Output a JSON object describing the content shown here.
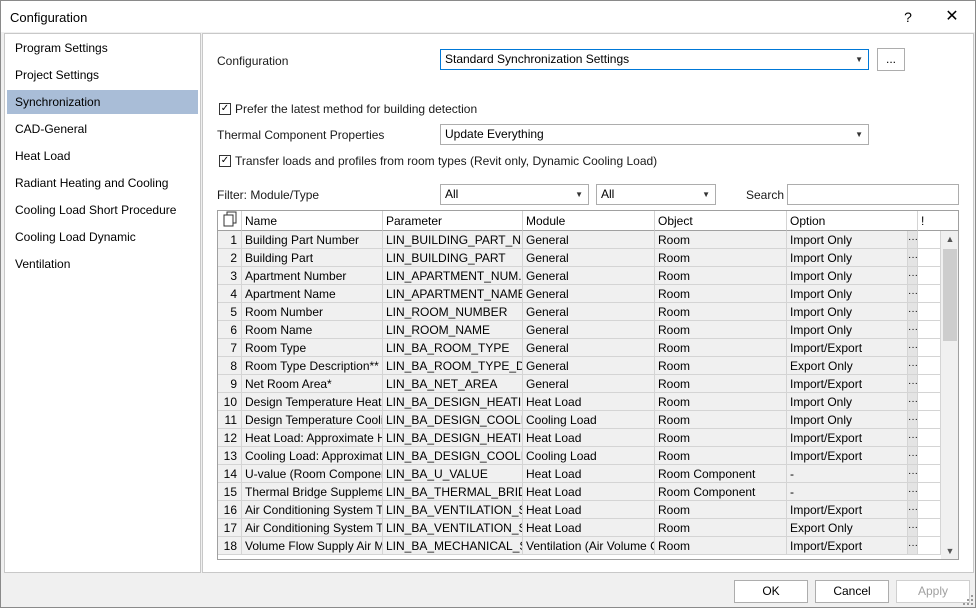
{
  "window": {
    "title": "Configuration",
    "help": "?",
    "close": "✕"
  },
  "sidebar": {
    "items": [
      {
        "label": "Program Settings",
        "active": false
      },
      {
        "label": "Project Settings",
        "active": false
      },
      {
        "label": "Synchronization",
        "active": true
      },
      {
        "label": "CAD-General",
        "active": false
      },
      {
        "label": "Heat Load",
        "active": false
      },
      {
        "label": "Radiant Heating and Cooling",
        "active": false
      },
      {
        "label": "Cooling Load Short Procedure",
        "active": false
      },
      {
        "label": "Cooling Load Dynamic",
        "active": false
      },
      {
        "label": "Ventilation",
        "active": false
      }
    ]
  },
  "config": {
    "label": "Configuration",
    "value": "Standard Synchronization Settings",
    "more_button": "..."
  },
  "prefer_latest": {
    "checked": true,
    "label": "Prefer the latest method for building detection"
  },
  "thermal": {
    "label": "Thermal Component Properties",
    "value": "Update Everything"
  },
  "transfer_loads": {
    "checked": true,
    "label": "Transfer loads and profiles from room types (Revit only, Dynamic Cooling Load)"
  },
  "filter": {
    "label": "Filter: Module/Type",
    "module_value": "All",
    "type_value": "All",
    "search_label": "Search",
    "search_value": ""
  },
  "table": {
    "headers": {
      "name": "Name",
      "parameter": "Parameter",
      "module": "Module",
      "object": "Object",
      "option": "Option",
      "flag": "!"
    },
    "rows": [
      {
        "n": "1",
        "name": "Building Part Number",
        "param": "LIN_BUILDING_PART_N...",
        "module": "General",
        "object": "Room",
        "option": "Import Only"
      },
      {
        "n": "2",
        "name": "Building Part",
        "param": "LIN_BUILDING_PART",
        "module": "General",
        "object": "Room",
        "option": "Import Only"
      },
      {
        "n": "3",
        "name": "Apartment Number",
        "param": "LIN_APARTMENT_NUM...",
        "module": "General",
        "object": "Room",
        "option": "Import Only"
      },
      {
        "n": "4",
        "name": "Apartment Name",
        "param": "LIN_APARTMENT_NAME",
        "module": "General",
        "object": "Room",
        "option": "Import Only"
      },
      {
        "n": "5",
        "name": "Room Number",
        "param": "LIN_ROOM_NUMBER",
        "module": "General",
        "object": "Room",
        "option": "Import Only"
      },
      {
        "n": "6",
        "name": "Room Name",
        "param": "LIN_ROOM_NAME",
        "module": "General",
        "object": "Room",
        "option": "Import Only"
      },
      {
        "n": "7",
        "name": "Room Type",
        "param": "LIN_BA_ROOM_TYPE",
        "module": "General",
        "object": "Room",
        "option": "Import/Export"
      },
      {
        "n": "8",
        "name": "Room Type Description**",
        "param": "LIN_BA_ROOM_TYPE_D...",
        "module": "General",
        "object": "Room",
        "option": "Export Only"
      },
      {
        "n": "9",
        "name": "Net Room Area*",
        "param": "LIN_BA_NET_AREA",
        "module": "General",
        "object": "Room",
        "option": "Import/Export"
      },
      {
        "n": "10",
        "name": "Design Temperature Heating",
        "param": "LIN_BA_DESIGN_HEATIN...",
        "module": "Heat Load",
        "object": "Room",
        "option": "Import Only"
      },
      {
        "n": "11",
        "name": "Design Temperature Cooling",
        "param": "LIN_BA_DESIGN_COOLIN...",
        "module": "Cooling Load",
        "object": "Room",
        "option": "Import Only"
      },
      {
        "n": "12",
        "name": "Heat Load: Approximate H...",
        "param": "LIN_BA_DESIGN_HEATIN...",
        "module": "Heat Load",
        "object": "Room",
        "option": "Import/Export"
      },
      {
        "n": "13",
        "name": "Cooling Load: Approximate ...",
        "param": "LIN_BA_DESIGN_COOLIN...",
        "module": "Cooling Load",
        "object": "Room",
        "option": "Import/Export"
      },
      {
        "n": "14",
        "name": "U-value (Room Component)",
        "param": "LIN_BA_U_VALUE",
        "module": "Heat Load",
        "object": "Room Component",
        "option": "-"
      },
      {
        "n": "15",
        "name": "Thermal Bridge Supplement...",
        "param": "LIN_BA_THERMAL_BRID...",
        "module": "Heat Load",
        "object": "Room Component",
        "option": "-"
      },
      {
        "n": "16",
        "name": "Air Conditioning System Ty...",
        "param": "LIN_BA_VENTILATION_S...",
        "module": "Heat Load",
        "object": "Room",
        "option": "Import/Export"
      },
      {
        "n": "17",
        "name": "Air Conditioning System Ty...",
        "param": "LIN_BA_VENTILATION_S...",
        "module": "Heat Load",
        "object": "Room",
        "option": "Export Only"
      },
      {
        "n": "18",
        "name": "Volume Flow Supply Air Me...",
        "param": "LIN_BA_MECHANICAL_S...",
        "module": "Ventilation (Air Volume Ca...",
        "object": "Room",
        "option": "Import/Export"
      }
    ]
  },
  "footer": {
    "ok": "OK",
    "cancel": "Cancel",
    "apply": "Apply"
  },
  "icons": {
    "help": "question-mark-icon",
    "close": "close-icon",
    "copy": "copy-icon",
    "dropdown": "chevron-down-icon",
    "check": "checkmark-icon"
  }
}
